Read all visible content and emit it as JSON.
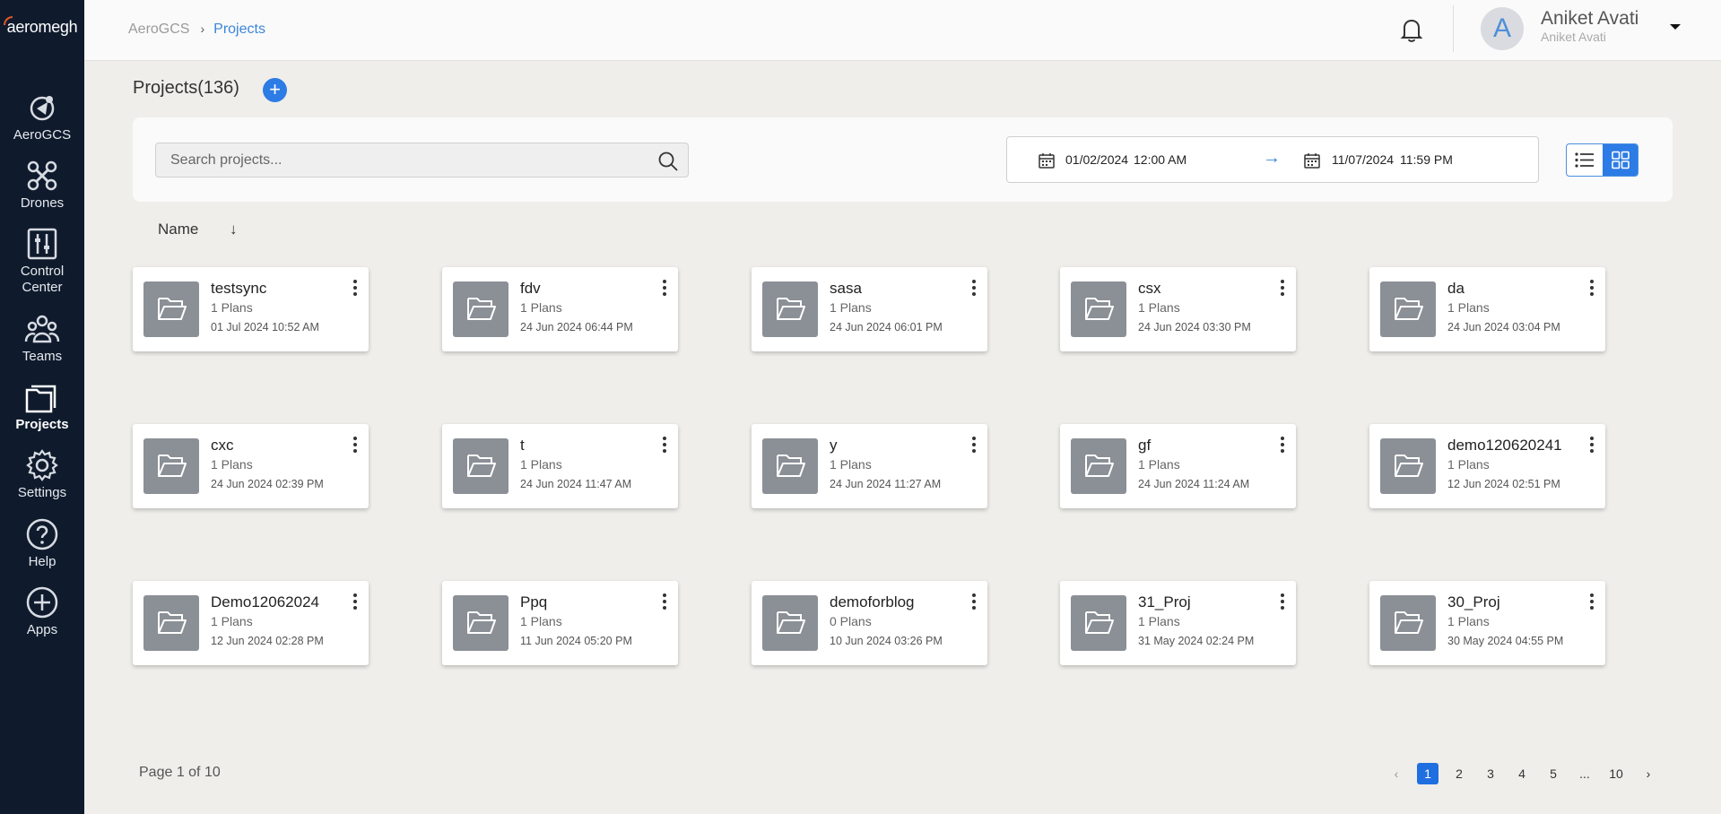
{
  "app": {
    "logo": "aeromegh"
  },
  "sidebar": {
    "items": [
      {
        "label": "AeroGCS",
        "icon": "aerogcs-icon"
      },
      {
        "label": "Drones",
        "icon": "drone-icon"
      },
      {
        "label": "Control Center",
        "icon": "control-center-icon"
      },
      {
        "label": "Teams",
        "icon": "teams-icon"
      },
      {
        "label": "Projects",
        "icon": "folder-icon",
        "active": true
      },
      {
        "label": "Settings",
        "icon": "gear-icon"
      },
      {
        "label": "Help",
        "icon": "help-icon"
      },
      {
        "label": "Apps",
        "icon": "plus-circle-icon"
      }
    ]
  },
  "breadcrumb": {
    "root": "AeroGCS",
    "separator": "›",
    "current": "Projects"
  },
  "user": {
    "initial": "A",
    "name": "Aniket Avati",
    "subtitle": "Aniket Avati"
  },
  "header": {
    "title": "Projects(136)",
    "add_label": "+"
  },
  "filters": {
    "search_placeholder": "Search projects...",
    "from_date": "01/02/2024",
    "from_time": "12:00 AM",
    "to_date": "11/07/2024",
    "to_time": "11:59 PM",
    "range_arrow": "→",
    "view_mode": "grid"
  },
  "sort": {
    "label": "Name",
    "arrow": "↓"
  },
  "projects": [
    {
      "name": "testsync",
      "plans": "1 Plans",
      "date": "01 Jul 2024 10:52 AM"
    },
    {
      "name": "fdv",
      "plans": "1 Plans",
      "date": "24 Jun 2024 06:44 PM"
    },
    {
      "name": "sasa",
      "plans": "1 Plans",
      "date": "24 Jun 2024 06:01 PM"
    },
    {
      "name": "csx",
      "plans": "1 Plans",
      "date": "24 Jun 2024 03:30 PM"
    },
    {
      "name": "da",
      "plans": "1 Plans",
      "date": "24 Jun 2024 03:04 PM"
    },
    {
      "name": "cxc",
      "plans": "1 Plans",
      "date": "24 Jun 2024 02:39 PM"
    },
    {
      "name": "t",
      "plans": "1 Plans",
      "date": "24 Jun 2024 11:47 AM"
    },
    {
      "name": "y",
      "plans": "1 Plans",
      "date": "24 Jun 2024 11:27 AM"
    },
    {
      "name": "gf",
      "plans": "1 Plans",
      "date": "24 Jun 2024 11:24 AM"
    },
    {
      "name": "demo120620241",
      "plans": "1 Plans",
      "date": "12 Jun 2024 02:51 PM"
    },
    {
      "name": "Demo12062024",
      "plans": "1 Plans",
      "date": "12 Jun 2024 02:28 PM"
    },
    {
      "name": "Ppq",
      "plans": "1 Plans",
      "date": "11 Jun 2024 05:20 PM"
    },
    {
      "name": "demoforblog",
      "plans": "0 Plans",
      "date": "10 Jun 2024 03:26 PM"
    },
    {
      "name": "31_Proj",
      "plans": "1 Plans",
      "date": "31 May 2024 02:24 PM"
    },
    {
      "name": "30_Proj",
      "plans": "1 Plans",
      "date": "30 May 2024 04:55 PM"
    }
  ],
  "pagination": {
    "info": "Page 1 of 10",
    "prev": "‹",
    "next": "›",
    "pages": [
      "1",
      "2",
      "3",
      "4",
      "5",
      "...",
      "10"
    ],
    "current": "1"
  },
  "colors": {
    "accent": "#2d7be5",
    "sidebar": "#0f1b2d",
    "folder": "#8b8f96"
  }
}
